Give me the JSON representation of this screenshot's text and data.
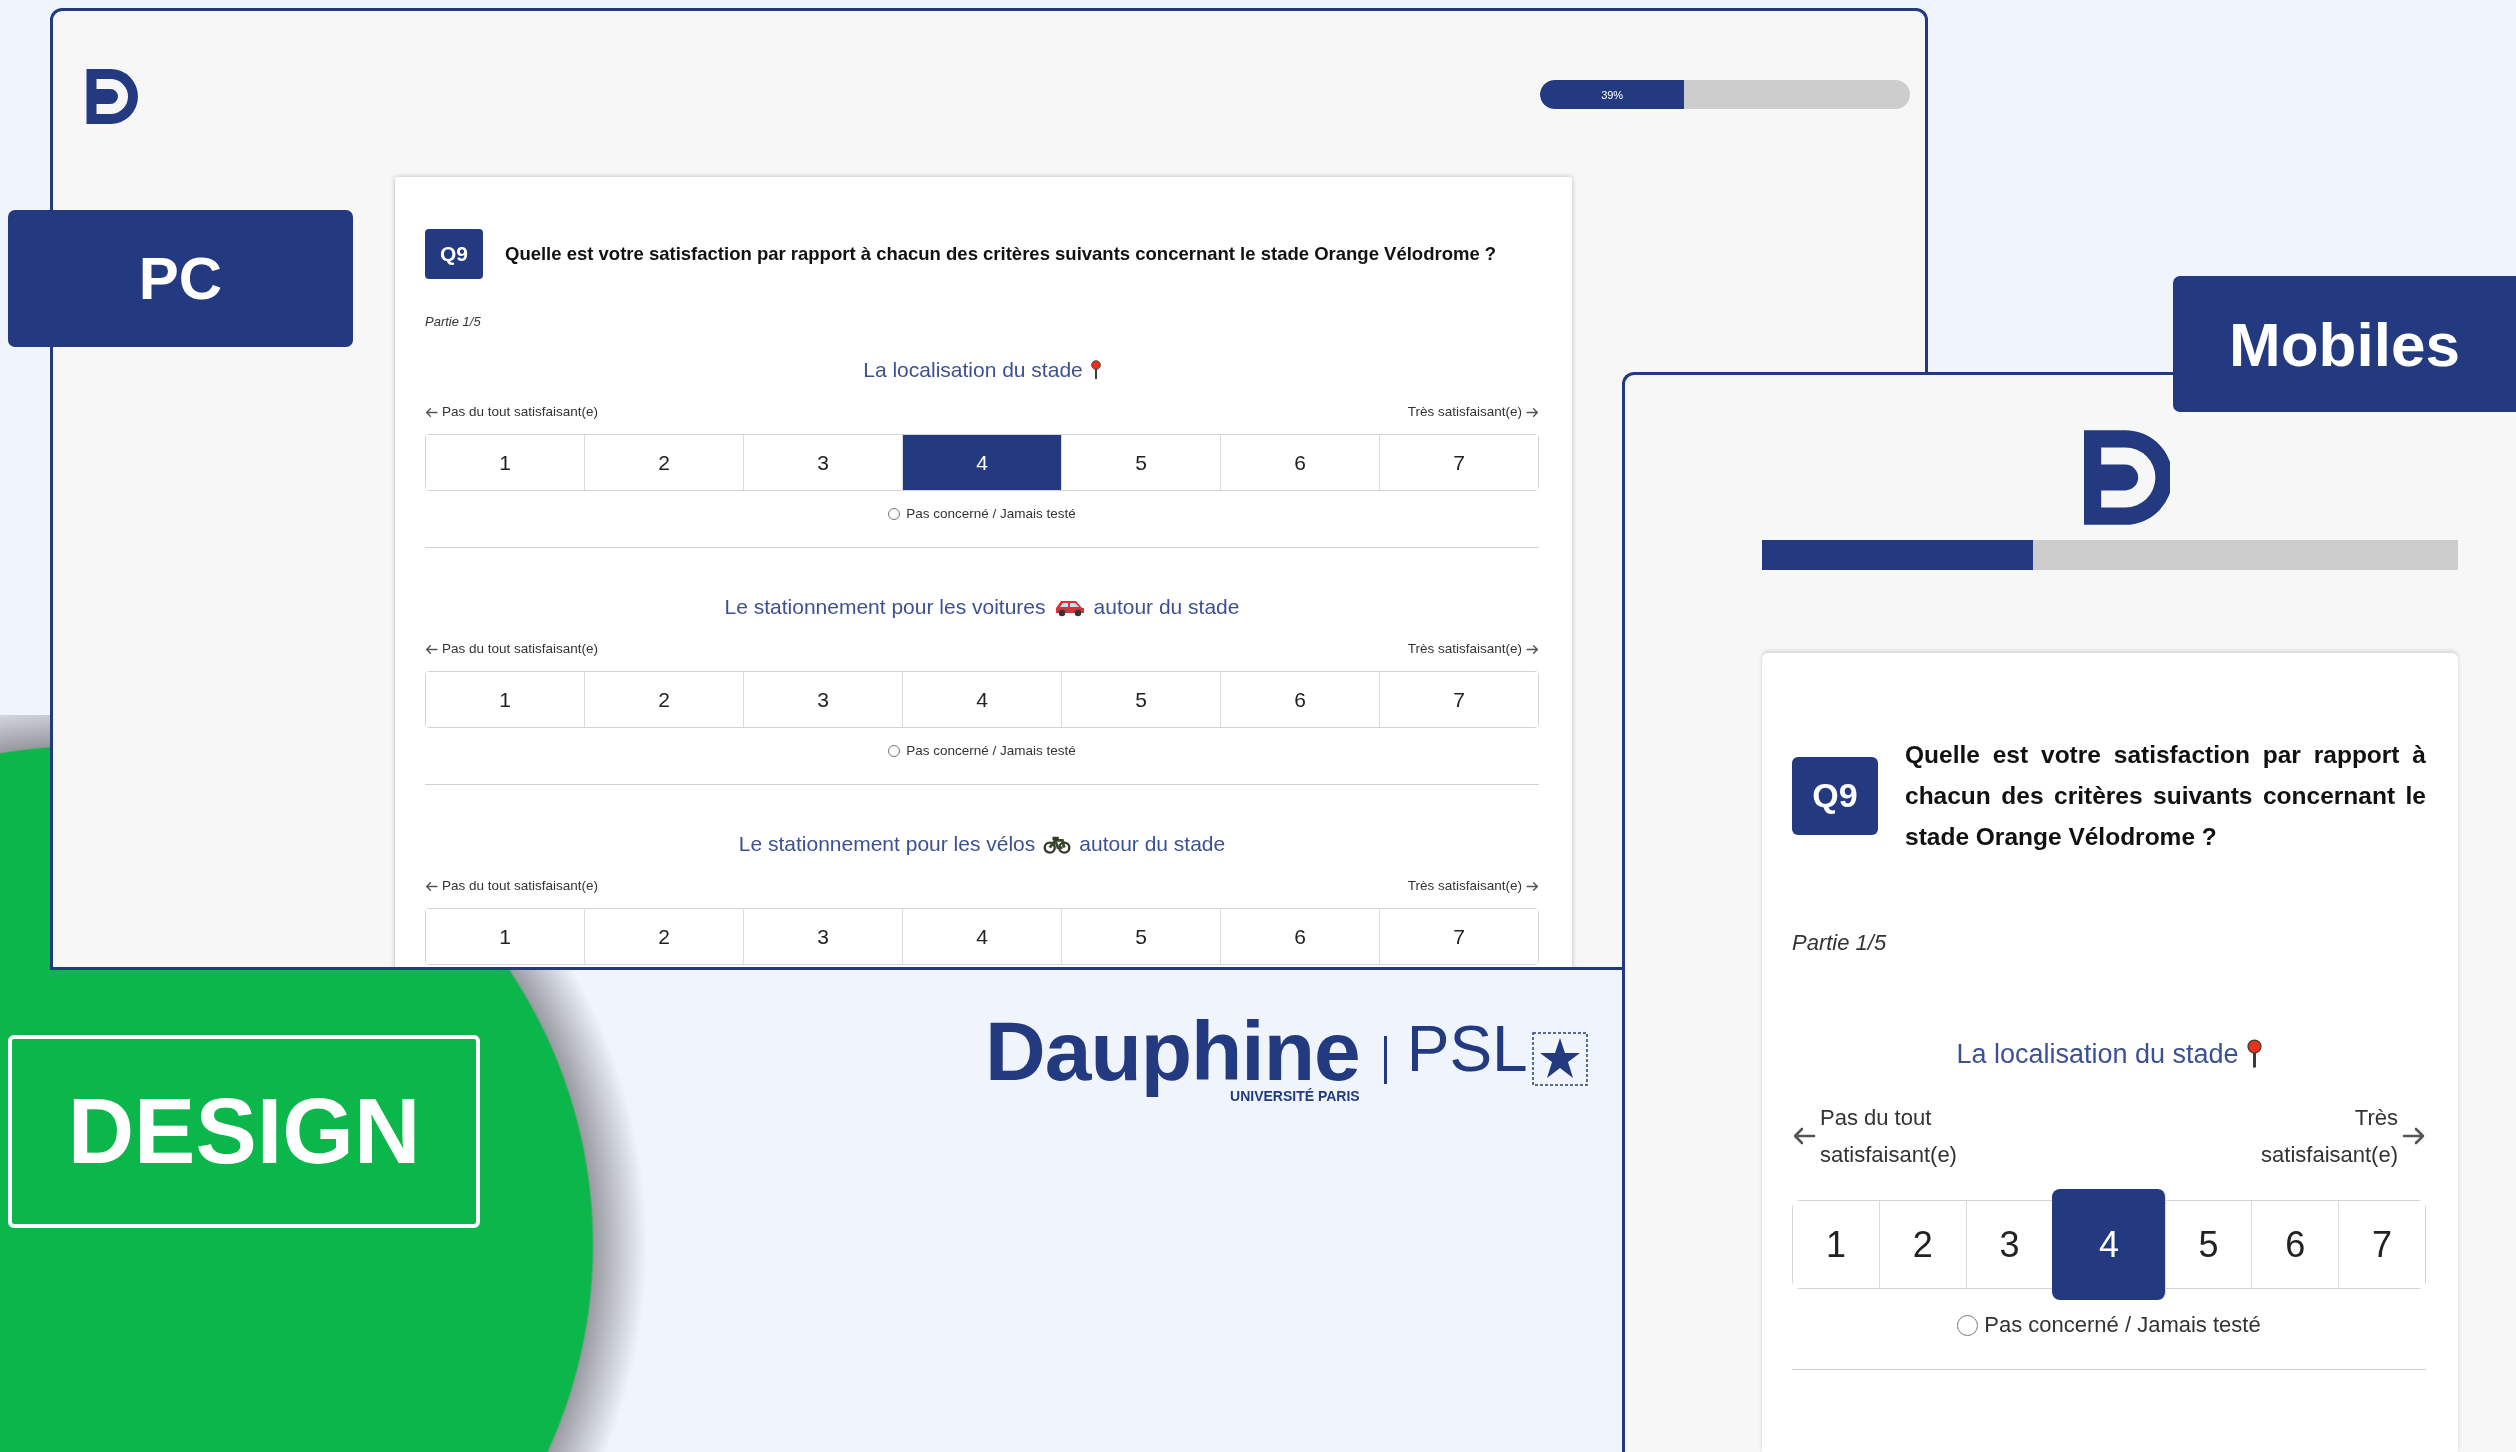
{
  "tags": {
    "pc": "PC",
    "mobile": "Mobiles",
    "design": "DESIGN"
  },
  "pc": {
    "progress": {
      "level": 0.39,
      "label": "39%"
    },
    "question": {
      "number": "Q9",
      "text": "Quelle est votre satisfaction par rapport à chacun des critères suivants concernant le stade Orange Vélodrome ?"
    },
    "part": "Partie 1/5",
    "criteria": [
      {
        "title": "La localisation du stade",
        "kind": "pin",
        "left": "Pas du tout satisfaisant(e)",
        "right": "Très satisfaisant(e)",
        "options": [
          {
            "label": "1",
            "selected": false
          },
          {
            "label": "2",
            "selected": false
          },
          {
            "label": "3",
            "selected": false
          },
          {
            "label": "4",
            "selected": true
          },
          {
            "label": "5",
            "selected": false
          },
          {
            "label": "6",
            "selected": false
          },
          {
            "label": "7",
            "selected": false
          }
        ],
        "not_concerned": {
          "label": "Pas concerné / Jamais testé",
          "checked": false
        }
      },
      {
        "title": "Le stationnement pour les voitures",
        "title_end": "autour du stade",
        "kind": "car",
        "left": "Pas du tout satisfaisant(e)",
        "right": "Très satisfaisant(e)",
        "options": [
          {
            "label": "1",
            "selected": false
          },
          {
            "label": "2",
            "selected": false
          },
          {
            "label": "3",
            "selected": false
          },
          {
            "label": "4",
            "selected": false
          },
          {
            "label": "5",
            "selected": false
          },
          {
            "label": "6",
            "selected": false
          },
          {
            "label": "7",
            "selected": false
          }
        ],
        "not_concerned": {
          "label": "Pas concerné / Jamais testé",
          "checked": false
        }
      },
      {
        "title": "Le stationnement pour les vélos",
        "title_end": "autour du stade",
        "kind": "bike",
        "left": "Pas du tout satisfaisant(e)",
        "right": "Très satisfaisant(e)",
        "options": [
          {
            "label": "1",
            "selected": false
          },
          {
            "label": "2",
            "selected": false
          },
          {
            "label": "3",
            "selected": false
          },
          {
            "label": "4",
            "selected": false
          },
          {
            "label": "5",
            "selected": false
          },
          {
            "label": "6",
            "selected": false
          },
          {
            "label": "7",
            "selected": false
          }
        ]
      }
    ]
  },
  "mobile": {
    "progress": {
      "level": 0.39
    },
    "question": {
      "number": "Q9",
      "text": "Quelle est votre satisfaction par rapport à chacun des critères suivants concernant le stade Orange Vélodrome ?"
    },
    "part": "Partie 1/5",
    "criteria": [
      {
        "title": "La localisation du stade",
        "kind": "pin",
        "left": "Pas du tout satisfaisant(e)",
        "right": "Très satisfaisant(e)",
        "options": [
          {
            "label": "1",
            "selected": false
          },
          {
            "label": "2",
            "selected": false
          },
          {
            "label": "3",
            "selected": false
          },
          {
            "label": "4",
            "selected": true
          },
          {
            "label": "5",
            "selected": false
          },
          {
            "label": "6",
            "selected": false
          },
          {
            "label": "7",
            "selected": false
          }
        ],
        "not_concerned": {
          "label": "Pas concerné / Jamais testé",
          "checked": false
        }
      }
    ]
  },
  "brand": {
    "name": "Dauphine",
    "subtitle": "UNIVERSITÉ PARIS",
    "partner": "PSL"
  }
}
